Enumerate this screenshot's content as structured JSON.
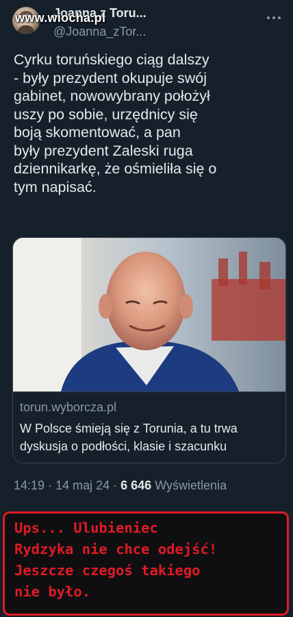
{
  "watermark": "www.wiocha.pl",
  "author": {
    "display_name": "Joanna z Toru...",
    "handle": "@Joanna_zTor...",
    "avatar_icon": "avatar-photo"
  },
  "more_icon": "more-options-icon",
  "tweet": {
    "text": "Cyrku toruńskiego ciąg dalszy\n- były prezydent okupuje swój\ngabinet, nowowybrany położył\nuszy po sobie, urzędnicy się\nboją skomentować, a pan\nbyły prezydent Zaleski ruga\ndziennikarkę, że ośmieliła się o\ntym napisać."
  },
  "link_card": {
    "domain": "torun.wyborcza.pl",
    "title": "W Polsce śmieją się z Torunia, a tu trwa dyskusja o podłości, klasie i szacunku"
  },
  "meta": {
    "time": "14:19",
    "date": "14 maj 24",
    "views_count": "6 646",
    "views_label": "Wyświetlenia"
  },
  "caption": {
    "text": "Ups... Ulubieniec\nRydzyka nie chce odejść!\nJeszcze czegoś takiego\nnie było."
  },
  "colors": {
    "background": "#15202b",
    "secondary_text": "#8b98a5",
    "caption_red": "#e01b24"
  }
}
